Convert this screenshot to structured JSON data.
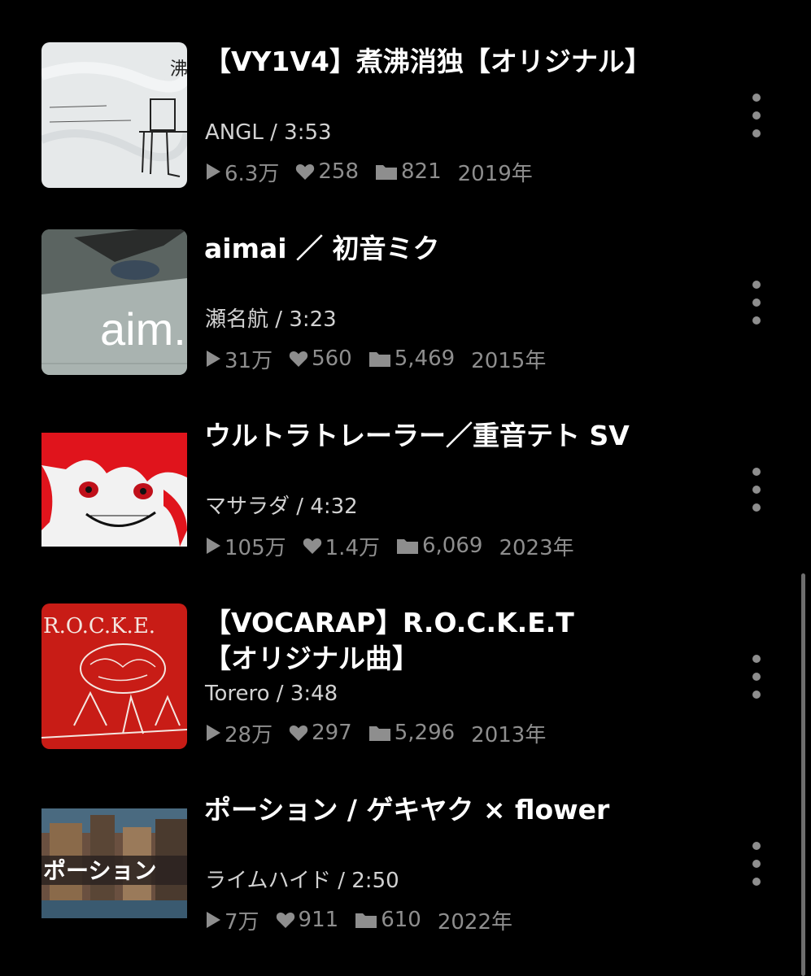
{
  "items": [
    {
      "title_line1": "【VY1V4】煮沸消独【オリジナル】",
      "title_line2": "",
      "artist": "ANGL",
      "duration": "3:53",
      "plays": "6.3万",
      "likes": "258",
      "mylists": "821",
      "year": "2019年"
    },
    {
      "title_line1": "aimai ／ 初音ミク",
      "title_line2": "",
      "artist": "瀬名航",
      "duration": "3:23",
      "plays": "31万",
      "likes": "560",
      "mylists": "5,469",
      "year": "2015年",
      "thumb_text": "aim."
    },
    {
      "title_line1": "ウルトラトレーラー／重音テト SV",
      "title_line2": "",
      "artist": "マサラダ",
      "duration": "4:32",
      "plays": "105万",
      "likes": "1.4万",
      "mylists": "6,069",
      "year": "2023年"
    },
    {
      "title_line1": "【VOCARAP】R.O.C.K.E.T",
      "title_line2": "【オリジナル曲】",
      "artist": "Torero",
      "duration": "3:48",
      "plays": "28万",
      "likes": "297",
      "mylists": "5,296",
      "year": "2013年",
      "thumb_text": "R.O.C.K.E."
    },
    {
      "title_line1": "ポーション / ゲキヤク × flower",
      "title_line2": "",
      "artist": "ライムハイド",
      "duration": "2:50",
      "plays": "7万",
      "likes": "911",
      "mylists": "610",
      "year": "2022年",
      "thumb_text": "ポーション"
    }
  ],
  "separator": " / ",
  "icons": {
    "play": "play-icon",
    "like": "heart-icon",
    "mylist": "folder-icon",
    "menu": "more-vertical-icon"
  },
  "colors": {
    "background": "#000000",
    "title": "#ffffff",
    "artist": "#d2d2d2",
    "stats": "#8e8e8e",
    "scrollbar": "#6e6e6e"
  }
}
